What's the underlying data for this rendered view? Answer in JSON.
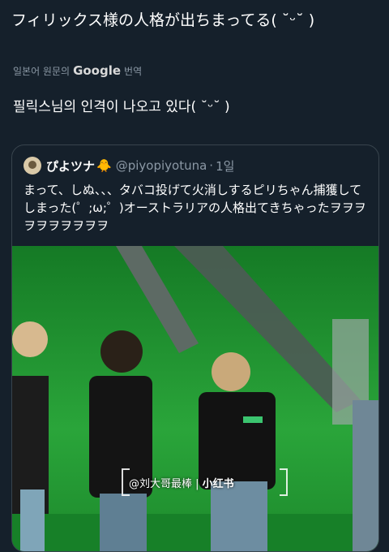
{
  "tweet": {
    "text": "フィリックス様の人格が出ちまってる( ˘ᵕ˘ )"
  },
  "translation": {
    "label_prefix": "일본어 원문의",
    "google": "Google",
    "label_suffix": "번역",
    "text": "필릭스님의 인격이 나오고 있다( ˘ᵕ˘ )"
  },
  "quote": {
    "display_name": "ぴよツナ",
    "name_emoji": "🐥",
    "handle": "@piyopiyotuna",
    "separator": "·",
    "time": "1일",
    "body": "まって、しぬ、、、タバコ投げて火消しするピリちゃん捕獲してしまった(゜;ω;゜)オーストラリアの人格出てきちゃったヲヲヲヲヲヲヲヲヲヲ",
    "watermark_left": "@刘大哥最棒",
    "watermark_right": "小红书"
  },
  "colors": {
    "background": "#15202b",
    "secondary_text": "#8b98a5",
    "border": "#38444d",
    "stage_green": "#1f8f2f"
  }
}
